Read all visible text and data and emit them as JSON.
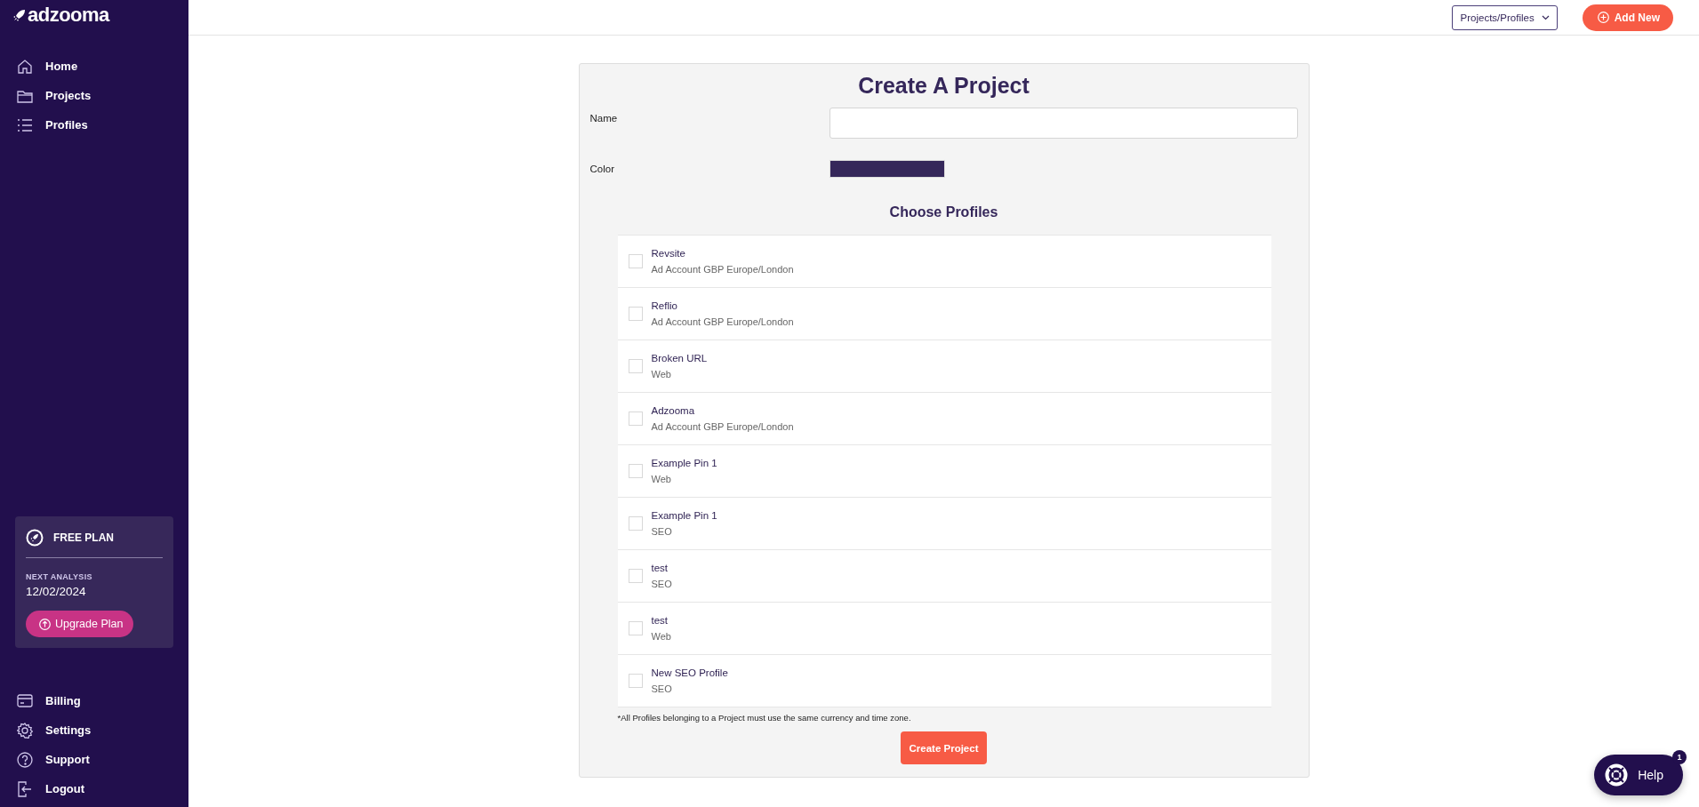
{
  "sidebar": {
    "logo": "adzooma",
    "nav": [
      {
        "label": "Home",
        "selected": false
      },
      {
        "label": "Projects",
        "selected": false
      },
      {
        "label": "Profiles",
        "selected": false
      }
    ],
    "plan": {
      "name": "FREE PLAN",
      "next_label": "NEXT ANALYSIS",
      "next_date": "12/02/2024",
      "button": "Upgrade Plan"
    },
    "bottom_nav": [
      {
        "label": "Billing"
      },
      {
        "label": "Settings"
      },
      {
        "label": "Support"
      },
      {
        "label": "Logout"
      }
    ]
  },
  "top_bar": {
    "dropdown": "Projects/Profiles",
    "add_button": "Add New"
  },
  "form": {
    "title": "Create A Project",
    "name_label": "Name",
    "color_label": "Color",
    "profiles_title": "Choose Profiles",
    "profiles": [
      {
        "name": "Revsite",
        "detail": "Ad Account GBP Europe/London",
        "checked": false
      },
      {
        "name": "Reflio",
        "detail": "Ad Account GBP Europe/London",
        "checked": false
      },
      {
        "name": "Broken URL",
        "detail": "Web",
        "checked": false
      },
      {
        "name": "Adzooma",
        "detail": "Ad Account GBP Europe/London",
        "checked": false
      },
      {
        "name": "Example Pin 1",
        "detail": "Web",
        "checked": false
      },
      {
        "name": "Example Pin 1",
        "detail": "SEO",
        "checked": false
      },
      {
        "name": "test",
        "detail": "SEO",
        "checked": false
      },
      {
        "name": "test",
        "detail": "Web",
        "checked": false
      },
      {
        "name": "New SEO Profile",
        "detail": "SEO",
        "checked": false
      }
    ],
    "note": "*All Profiles belonging to a Project must use the same currency and time zone.",
    "submit": "Create Project"
  },
  "help": {
    "label": "Help",
    "badge": "1"
  }
}
